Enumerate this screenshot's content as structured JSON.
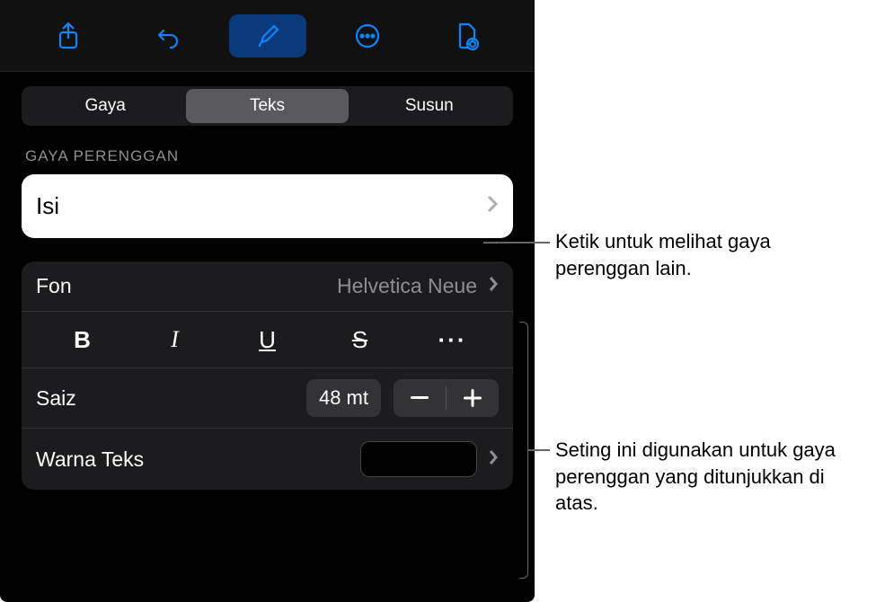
{
  "toolbar": {
    "share_icon": "share",
    "undo_icon": "undo",
    "format_icon": "format-brush",
    "more_icon": "more",
    "doc_icon": "document-options"
  },
  "tabs": {
    "style": "Gaya",
    "text": "Teks",
    "arrange": "Susun"
  },
  "section_label": "GAYA PERENGGAN",
  "paragraph_style": "Isi",
  "font": {
    "label": "Fon",
    "value": "Helvetica Neue"
  },
  "formatting": {
    "bold": "B",
    "italic": "I",
    "underline": "U",
    "strike": "S",
    "more": "···"
  },
  "size": {
    "label": "Saiz",
    "value": "48 mt"
  },
  "text_color": {
    "label": "Warna Teks",
    "value": "#000000"
  },
  "annotations": {
    "paragraph_style": "Ketik untuk melihat gaya perenggan lain.",
    "settings": "Seting ini digunakan untuk gaya perenggan yang ditunjukkan di atas."
  }
}
